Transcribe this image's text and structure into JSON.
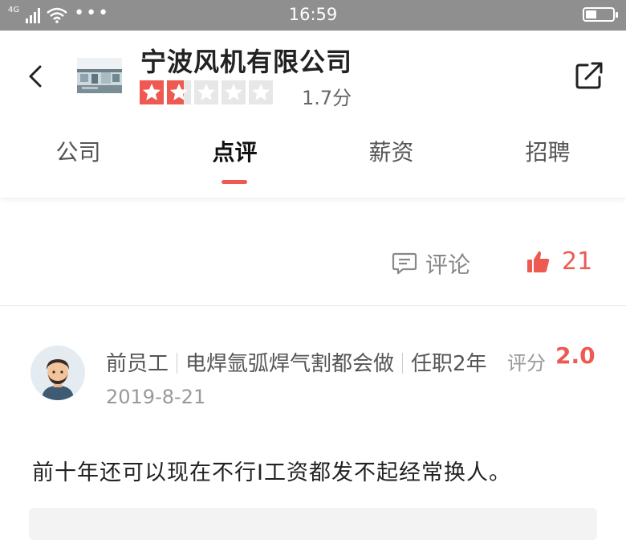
{
  "status_bar": {
    "network": "4G",
    "time": "16:59",
    "battery_level": 0.4
  },
  "company": {
    "name": "宁波风机有限公司",
    "rating": 1.7,
    "rating_text": "1.7分",
    "stars_total": 5,
    "rating_color": "#ee5a52"
  },
  "tabs": [
    {
      "label": "公司"
    },
    {
      "label": "点评"
    },
    {
      "label": "薪资"
    },
    {
      "label": "招聘"
    }
  ],
  "active_tab": 1,
  "prev_review": {
    "comment_label": "评论",
    "likes": "21"
  },
  "review": {
    "author": "前员工",
    "position": "电焊氩弧焊气割都会做",
    "tenure": "任职2年",
    "score_label": "评分",
    "score": "2.0",
    "date": "2019-8-21",
    "text": "前十年还可以现在不行I工资都发不起经常换人。"
  },
  "icons": {
    "back": "chevron-left-icon",
    "share": "share-icon",
    "comment": "comment-icon",
    "like": "thumbs-up-icon"
  }
}
